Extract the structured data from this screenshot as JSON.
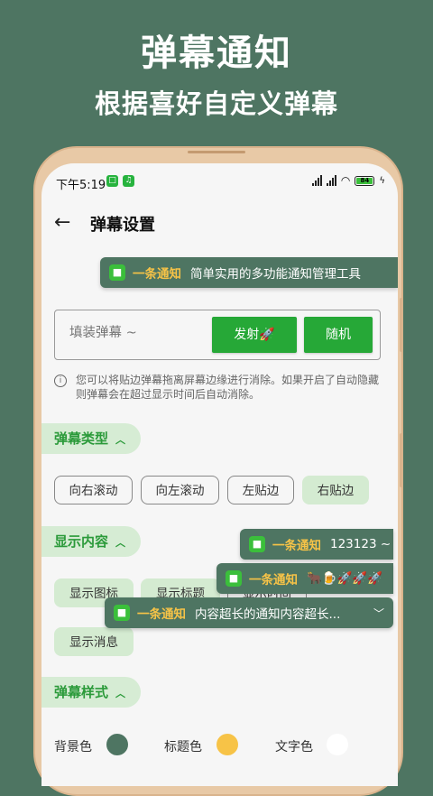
{
  "promo": {
    "title": "弹幕通知",
    "subtitle": "根据喜好自定义弹幕"
  },
  "status_bar": {
    "time": "下午5:19",
    "battery": "84"
  },
  "app_bar": {
    "back_icon": "←",
    "title": "弹幕设置"
  },
  "preview_toast": {
    "app": "一条通知",
    "text": "简单实用的多功能通知管理工具"
  },
  "input": {
    "placeholder": "填装弹幕 ~",
    "fire_label": "发射🚀",
    "random_label": "随机"
  },
  "hint": "您可以将贴边弹幕拖离屏幕边缘进行消除。如果开启了自动隐藏则弹幕会在超过显示时间后自动消除。",
  "sections": {
    "type": {
      "label": "弹幕类型",
      "options": [
        "向右滚动",
        "向左滚动",
        "左贴边",
        "右贴边"
      ],
      "selected": "右贴边"
    },
    "content": {
      "label": "显示内容",
      "options": [
        "显示图标",
        "显示标题",
        "显示时间",
        "显示消息"
      ]
    },
    "style": {
      "label": "弹幕样式",
      "colors": [
        {
          "label": "背景色",
          "color": "#4e7562"
        },
        {
          "label": "标题色",
          "color": "#f7c347"
        },
        {
          "label": "文字色",
          "color": "#ffffff"
        }
      ]
    }
  },
  "floating_toasts": [
    {
      "app": "一条通知",
      "text": "123123 ~"
    },
    {
      "app": "一条通知",
      "text": "🐂🍺🚀🚀🚀"
    },
    {
      "app": "一条通知",
      "text": "内容超长的通知内容超长..."
    }
  ],
  "colors": {
    "accent": "#26a837",
    "brand": "#4e7562",
    "title_yellow": "#f7c347"
  }
}
